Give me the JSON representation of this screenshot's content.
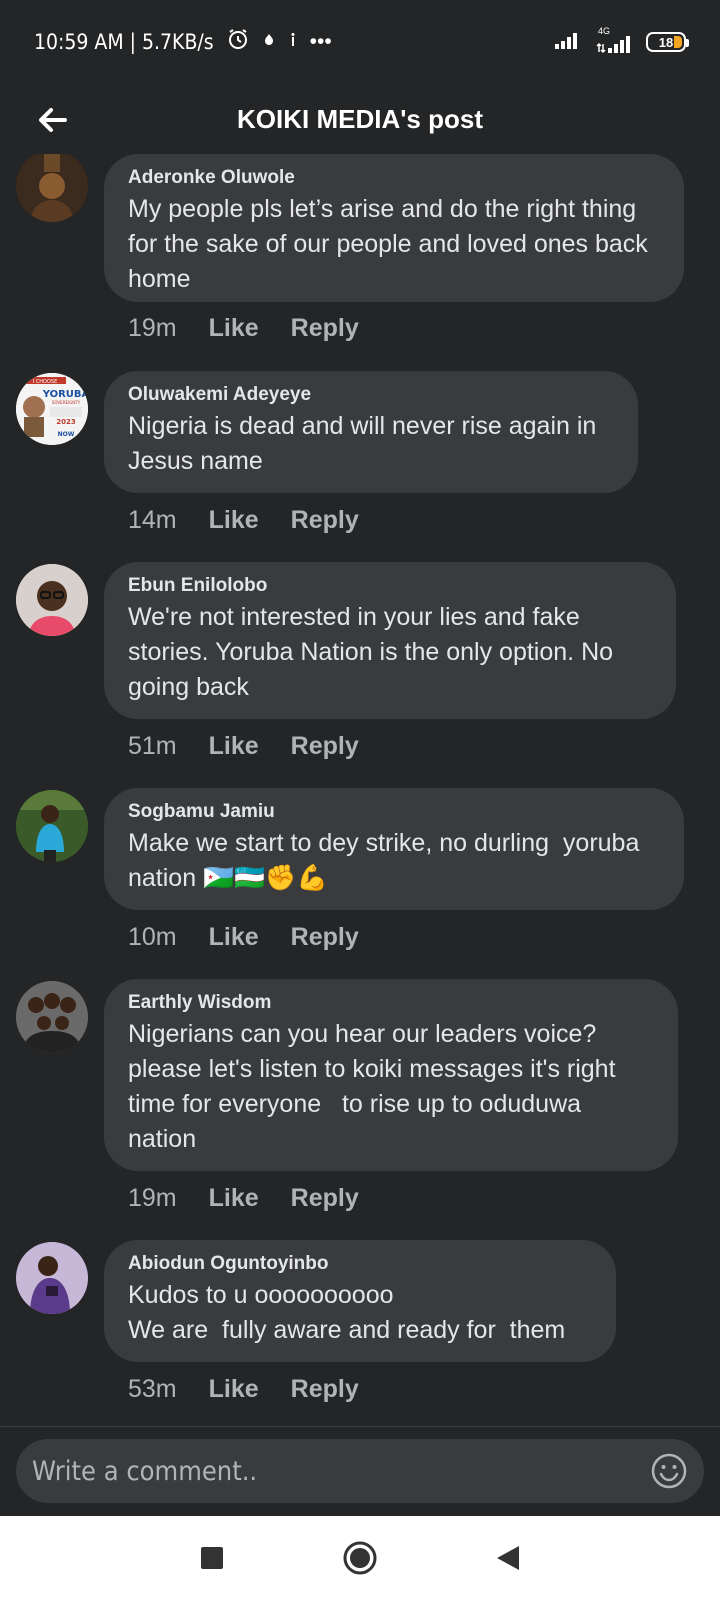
{
  "status": {
    "time": "10:59 AM | 5.7KB/s",
    "more": "•••",
    "network": "4G",
    "battery": "18"
  },
  "header": {
    "title": "KOIKI MEDIA's post"
  },
  "comments": [
    {
      "author": "Aderonke Oluwole",
      "text": "My people pls let’s arise and do the right thing for the sake of our people and loved ones back home",
      "time": "19m",
      "like": "Like",
      "reply": "Reply"
    },
    {
      "author": "Oluwakemi Adeyeye",
      "text": "Nigeria is dead and will never rise again in Jesus name",
      "time": "14m",
      "like": "Like",
      "reply": "Reply",
      "avatar_text": {
        "top": "I CHOOSE",
        "main": "YORUBA",
        "sub": "SOVEREIGNTY",
        "now": "NOW",
        "year": "2023"
      }
    },
    {
      "author": "Ebun Enilolobo",
      "text": "We're not interested in your lies and fake stories. Yoruba Nation is the only option. No going back",
      "time": "51m",
      "like": "Like",
      "reply": "Reply"
    },
    {
      "author": "Sogbamu Jamiu",
      "text": "Make we start to dey strike, no durling  yoruba nation 🇩🇯🇺🇿✊💪",
      "time": "10m",
      "like": "Like",
      "reply": "Reply"
    },
    {
      "author": "Earthly Wisdom",
      "text": "Nigerians can you hear our leaders voice? please let's listen to koiki messages it's right time for everyone   to rise up to oduduwa nation",
      "time": "19m",
      "like": "Like",
      "reply": "Reply"
    },
    {
      "author": "Abiodun Oguntoyinbo",
      "text": "Kudos to u oooooooooo\nWe are  fully aware and ready for  them",
      "time": "53m",
      "like": "Like",
      "reply": "Reply"
    }
  ],
  "composer": {
    "placeholder": "Write a comment.."
  },
  "colors": {
    "background": "#242526",
    "bubble": "#3a3b3c",
    "text": "#e4e6eb",
    "muted": "#b0b3b8",
    "battery": "#f5a623"
  }
}
